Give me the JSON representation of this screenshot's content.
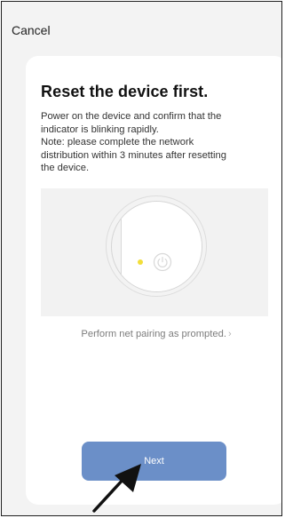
{
  "topbar": {
    "cancel_label": "Cancel"
  },
  "card": {
    "title": "Reset the device first.",
    "description_lines": [
      "Power on the device and confirm that the",
      "indicator is blinking rapidly.",
      "Note: please complete the network",
      "distribution within 3 minutes after resetting",
      "the device."
    ],
    "pairing_link_label": "Perform net pairing as prompted.",
    "next_label": "Next"
  },
  "icons": {
    "power": "power-icon",
    "chevron": "chevron-right-icon",
    "pointer": "arrow-pointer-icon"
  },
  "colors": {
    "next_button": "#6b8fc8",
    "indicator_dot": "#f2de3a",
    "page_background": "#f3f3f3"
  }
}
